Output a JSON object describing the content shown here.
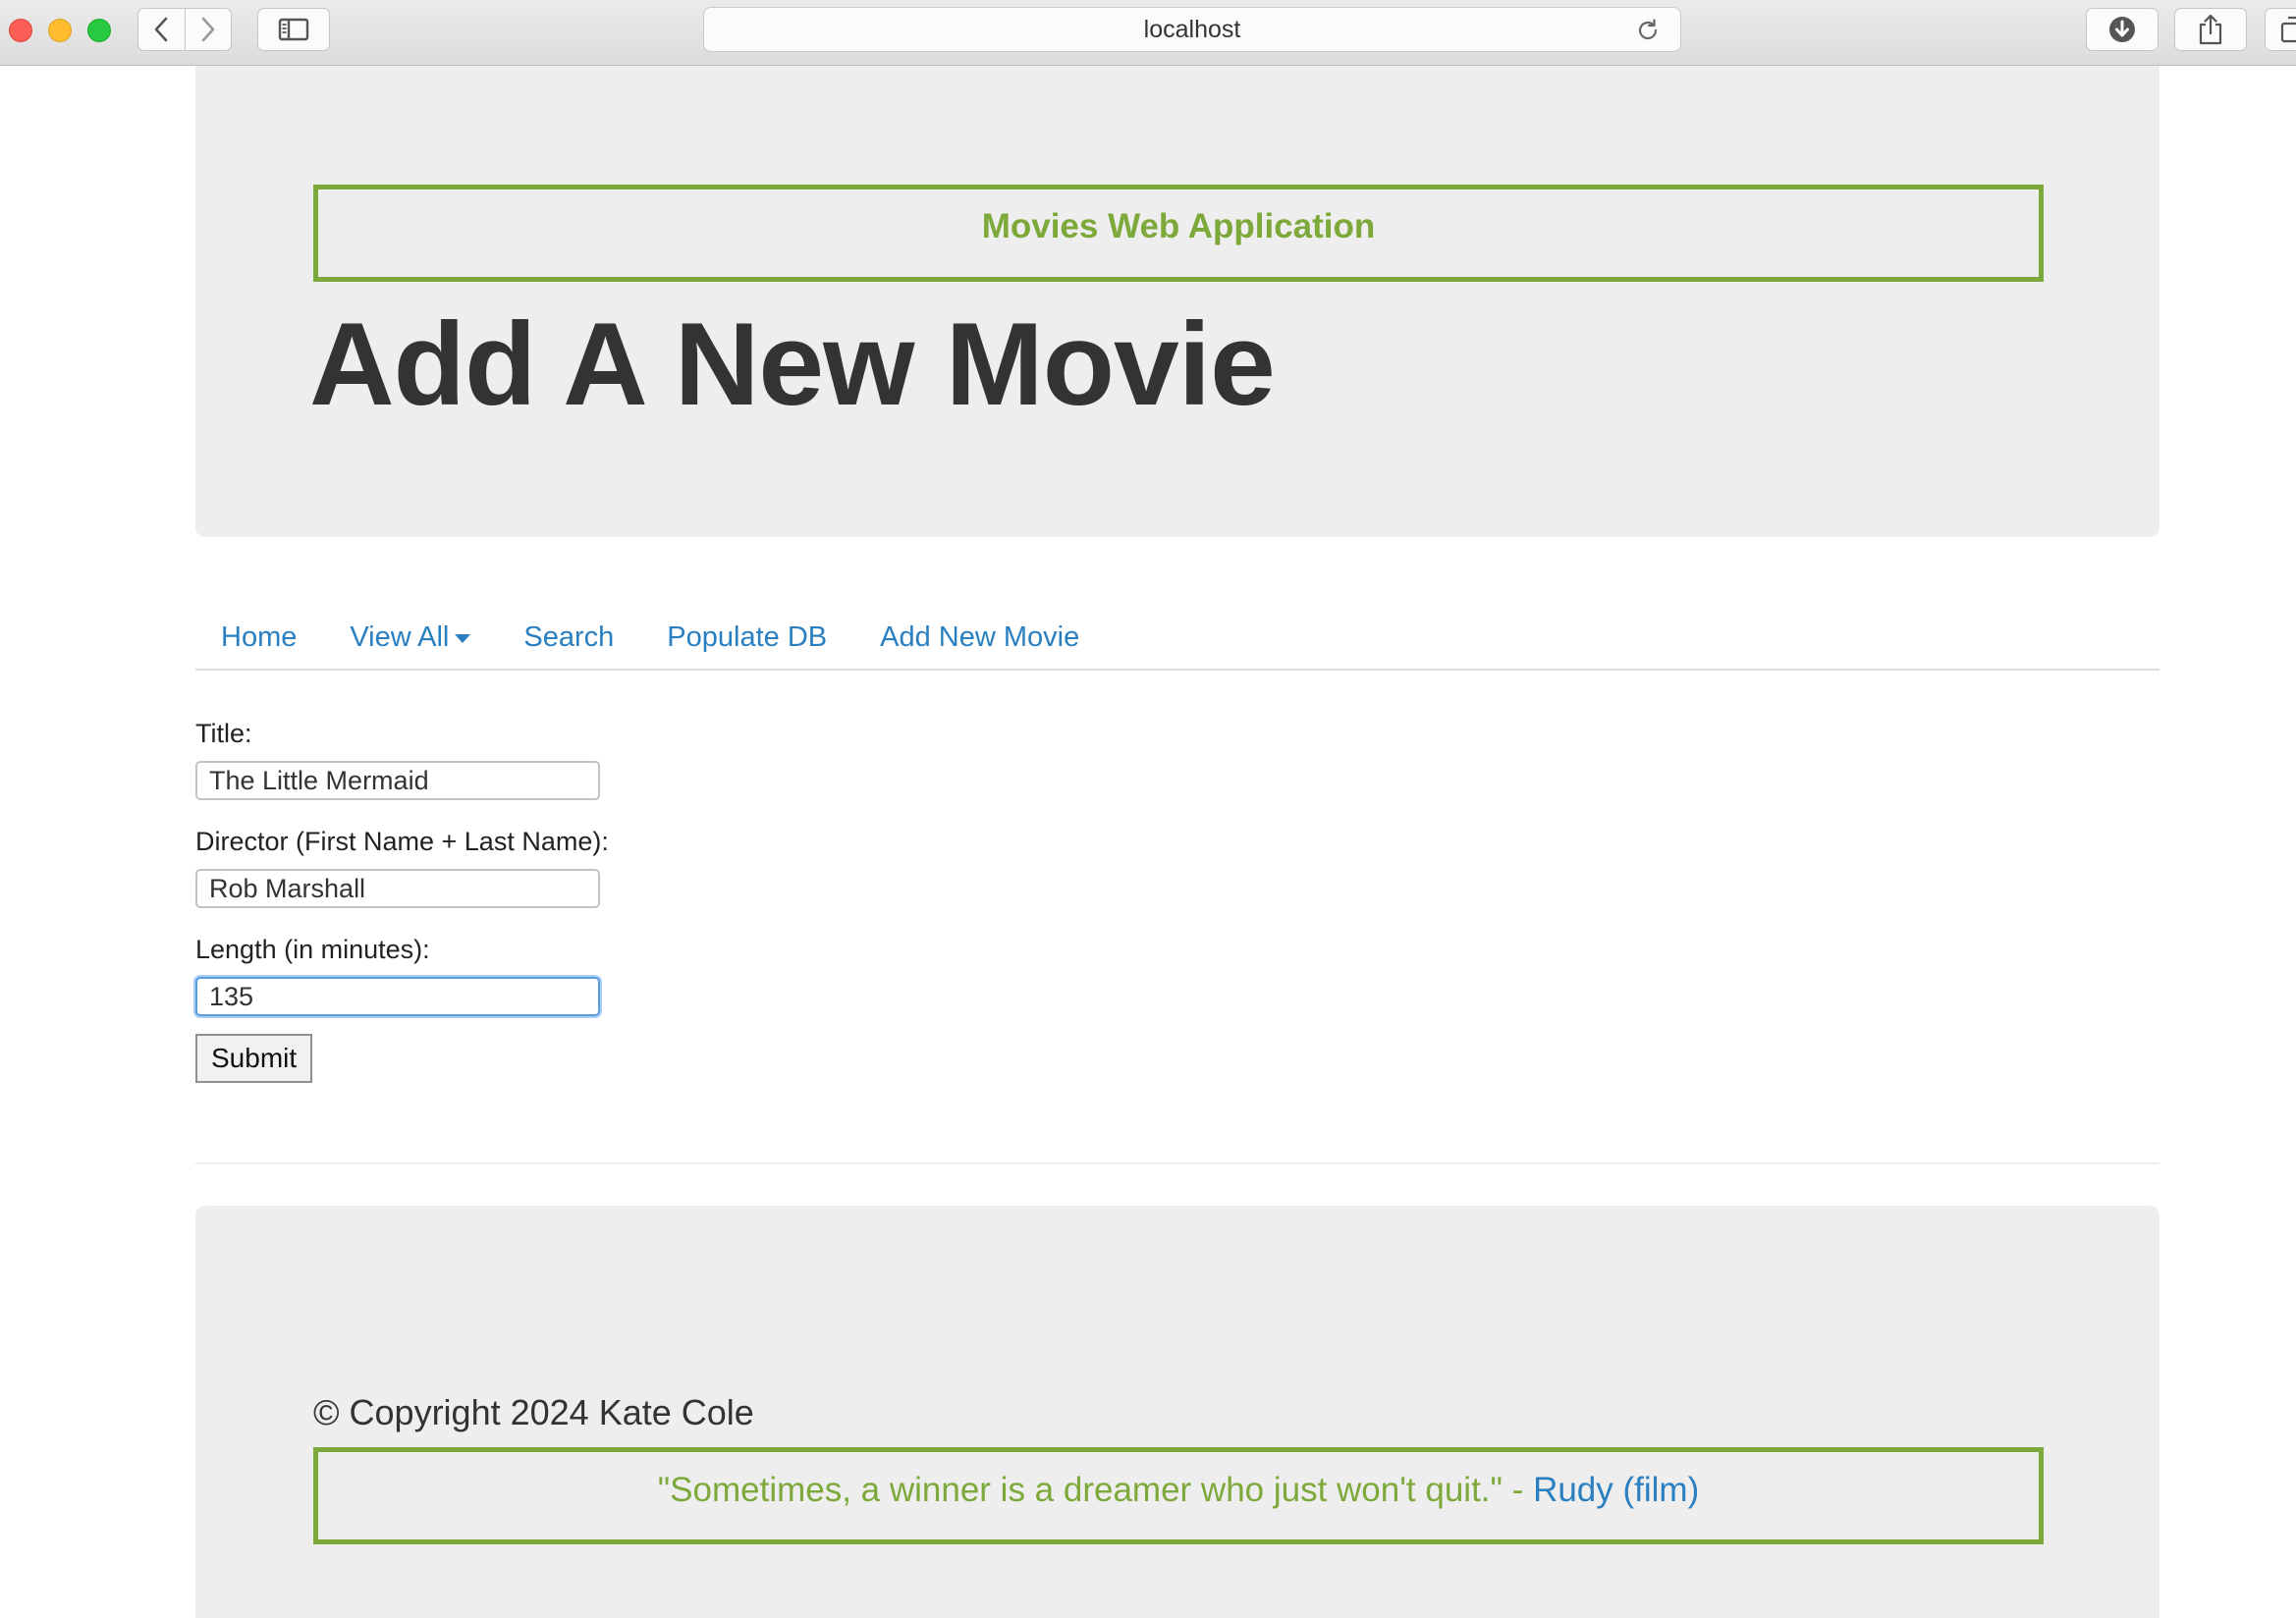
{
  "browser": {
    "url": "localhost"
  },
  "header": {
    "app_title": "Movies Web Application",
    "page_heading": "Add A New Movie"
  },
  "nav": {
    "items": [
      {
        "label": "Home"
      },
      {
        "label": "View All",
        "has_dropdown": true
      },
      {
        "label": "Search"
      },
      {
        "label": "Populate DB"
      },
      {
        "label": "Add New Movie"
      }
    ]
  },
  "form": {
    "title_label": "Title:",
    "title_value": "The Little Mermaid",
    "director_label": "Director (First Name + Last Name):",
    "director_value": "Rob Marshall",
    "length_label": "Length (in minutes):",
    "length_value": "135",
    "submit_label": "Submit"
  },
  "footer": {
    "copyright": "© Copyright 2024 Kate Cole",
    "quote_text": "\"Sometimes, a winner is a dreamer who just won't quit.\" - ",
    "quote_source": "Rudy (film)"
  },
  "colors": {
    "accent_green": "#7da83a",
    "link_blue": "#2a7fc1",
    "panel_gray": "#eeeeee",
    "heading_text": "#333333"
  },
  "icons": [
    "back-icon",
    "forward-icon",
    "sidebar-icon",
    "reload-icon",
    "download-icon",
    "share-icon",
    "tabs-icon"
  ]
}
